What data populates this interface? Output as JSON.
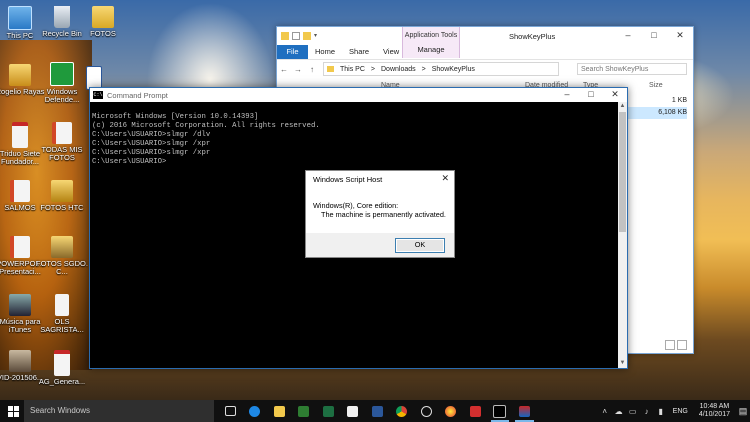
{
  "desktop": {
    "icons": [
      {
        "label": "This PC"
      },
      {
        "label": "Recycle Bin"
      },
      {
        "label": "FOTOS"
      },
      {
        "label": "Rogelio Rayas"
      },
      {
        "label": "Windows Defende..."
      },
      {
        "label": "Triduo Siete Fundador..."
      },
      {
        "label": "TODAS MIS FOTOS"
      },
      {
        "label": "SALMOS"
      },
      {
        "label": "FOTOS HTC"
      },
      {
        "label": "POWERPOI... Presentaci..."
      },
      {
        "label": "FOTOS SGDO. C..."
      },
      {
        "label": "Música para iTunes"
      },
      {
        "label": "OLS SAGRISTA..."
      },
      {
        "label": "VID-201506..."
      },
      {
        "label": "AG_Genera..."
      }
    ]
  },
  "explorer": {
    "context_tab_title": "Application Tools",
    "window_title": "ShowKeyPlus",
    "ribbon_tabs": [
      "File",
      "Home",
      "Share",
      "View",
      "Manage"
    ],
    "address": [
      "This PC",
      ">",
      "Downloads",
      ">",
      "ShowKeyPlus"
    ],
    "search_placeholder": "Search ShowKeyPlus",
    "columns": [
      "Name",
      "Date modified",
      "Type",
      "Size"
    ],
    "sizes": [
      "1 KB",
      "6,108 KB"
    ]
  },
  "cmd": {
    "title": "Command Prompt",
    "lines": [
      "Microsoft Windows [Version 10.0.14393]",
      "(c) 2016 Microsoft Corporation. All rights reserved.",
      "",
      "C:\\Users\\USUARIO>slmgr /dlv",
      "",
      "C:\\Users\\USUARIO>slmgr /xpr",
      "",
      "C:\\Users\\USUARIO>slmgr /xpr",
      "",
      "C:\\Users\\USUARIO>"
    ]
  },
  "dialog": {
    "title": "Windows Script Host",
    "line1": "Windows(R), Core edition:",
    "line2": "The machine is permanently activated.",
    "ok_label": "OK"
  },
  "taskbar": {
    "search_placeholder": "Search Windows",
    "apps": [
      "task-view",
      "edge",
      "file-explorer",
      "store",
      "excel",
      "windows",
      "word",
      "chrome",
      "media",
      "photos",
      "acrobat",
      "command-prompt",
      "showkeyplus"
    ],
    "language": "ENG",
    "time": "10:48 AM",
    "date": "4/10/2017"
  },
  "colors": {
    "accent": "#1f6fc0",
    "ribbon_context": "#f6e9f7",
    "taskbar": "#101010"
  }
}
